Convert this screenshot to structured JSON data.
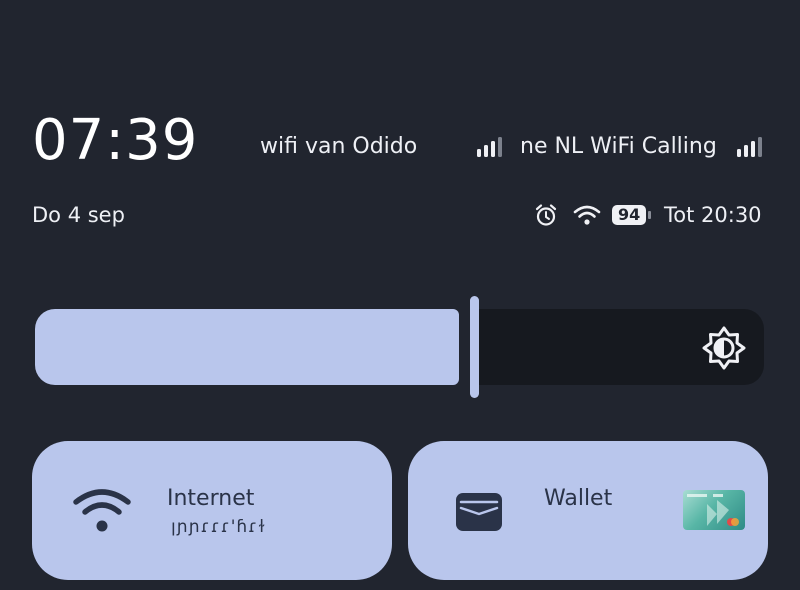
{
  "status": {
    "time": "07:39",
    "date": "Do 4 sep",
    "carriers": [
      {
        "name": "wifi van Odido"
      },
      {
        "name": "ne NL WiFi Calling"
      }
    ],
    "battery_level": "94",
    "charge_text": "Tot 20:30"
  },
  "brightness": {
    "level_fraction": 0.6
  },
  "tiles": {
    "internet": {
      "label": "Internet",
      "subtitle": "ꞁɲɲɾɾɾ'ɦɾɫ"
    },
    "wallet": {
      "label": "Wallet"
    }
  },
  "colors": {
    "background": "#21252f",
    "accent": "#b9c6ec",
    "tile_text": "#2a3348"
  },
  "icons": [
    "signal-bars-icon",
    "alarm-icon",
    "wifi-icon",
    "battery-icon",
    "brightness-icon",
    "wallet-icon",
    "card-thumbnail"
  ]
}
